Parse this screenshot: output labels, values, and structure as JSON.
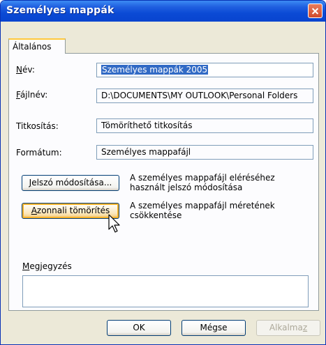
{
  "window": {
    "title": "Személyes mappák"
  },
  "tabs": [
    {
      "label": "Általános"
    }
  ],
  "fields": {
    "name": {
      "label_u": "N",
      "label_rest": "év:",
      "value": "Személyes mappák 2005"
    },
    "filename": {
      "label_u": "F",
      "label_rest": "ájlnév:",
      "value": "D:\\DOCUMENTS\\MY OUTLOOK\\Personal Folders"
    },
    "encryption": {
      "label": "Titkosítás:",
      "value": "Tömöríthető titkosítás"
    },
    "format": {
      "label": "Formátum:",
      "value": "Személyes mappafájl"
    }
  },
  "actions": {
    "password": {
      "label_u": "J",
      "label_rest": "elszó módosítása...",
      "desc_line1": "A személyes mappafájl eléréséhez",
      "desc_line2": "használt jelszó módosítása"
    },
    "compact": {
      "label_u": "A",
      "label_rest": "zonnali tömörítés",
      "desc_line1": "A személyes mappafájl méretének",
      "desc_line2": "csökkentése"
    }
  },
  "notes": {
    "label_u": "M",
    "label_rest": "egjegyzés",
    "value": ""
  },
  "buttons": {
    "ok": "OK",
    "cancel": "Mégse",
    "apply_main": "Alkalma",
    "apply_u": "z"
  },
  "colors": {
    "titlebar": "#0b4ad5",
    "close": "#d04a2c",
    "focus": "#f8b32c",
    "selection": "#316ac5"
  }
}
